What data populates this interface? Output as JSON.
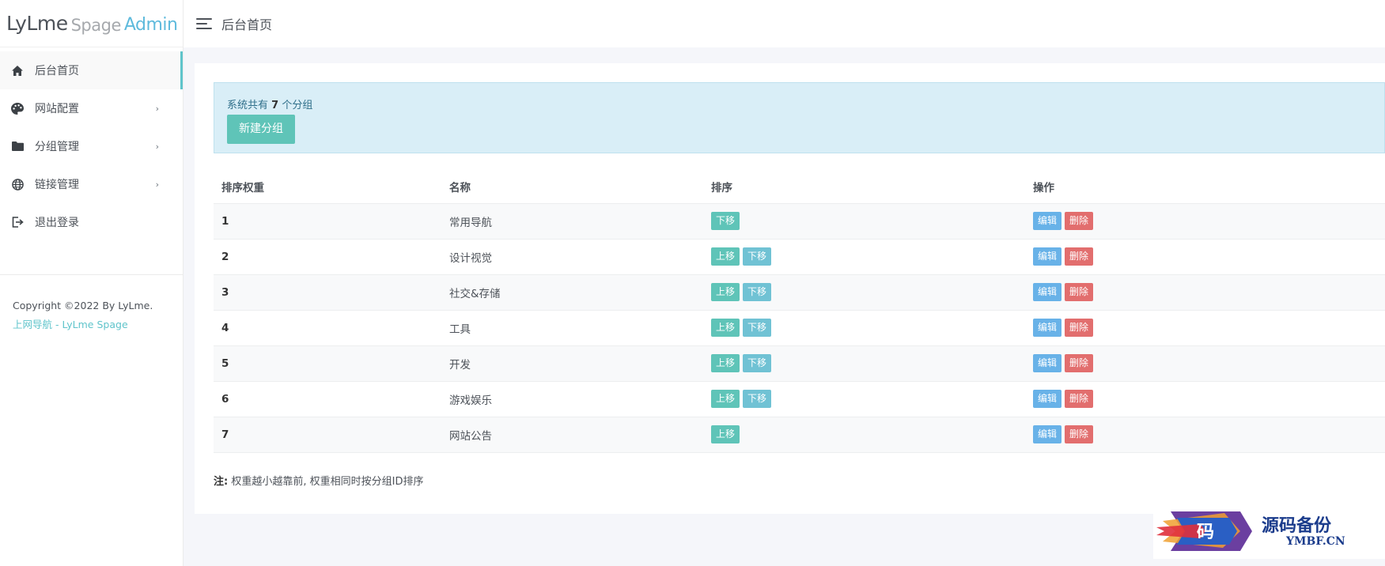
{
  "brand": {
    "part1": "LyLme",
    "part2": "Spage",
    "part3": "Admin"
  },
  "header": {
    "title": "后台首页"
  },
  "sidebar": {
    "items": [
      {
        "label": "后台首页",
        "icon": "home-icon",
        "active": true
      },
      {
        "label": "网站配置",
        "icon": "palette-icon",
        "has_submenu": true
      },
      {
        "label": "分组管理",
        "icon": "folder-icon",
        "has_submenu": true
      },
      {
        "label": "链接管理",
        "icon": "globe-icon",
        "has_submenu": true
      },
      {
        "label": "退出登录",
        "icon": "logout-icon"
      }
    ],
    "copyright": "Copyright ©2022 By LyLme.",
    "link": "上网导航 - LyLme Spage"
  },
  "alert": {
    "prefix": "系统共有",
    "count": "7",
    "suffix": "个分组",
    "new_button": "新建分组"
  },
  "table": {
    "headers": [
      "排序权重",
      "名称",
      "排序",
      "操作"
    ],
    "rows": [
      {
        "weight": "1",
        "name": "常用导航",
        "up": false,
        "down": true
      },
      {
        "weight": "2",
        "name": "设计视觉",
        "up": true,
        "down": true
      },
      {
        "weight": "3",
        "name": "社交&存储",
        "up": true,
        "down": true
      },
      {
        "weight": "4",
        "name": "工具",
        "up": true,
        "down": true
      },
      {
        "weight": "5",
        "name": "开发",
        "up": true,
        "down": true
      },
      {
        "weight": "6",
        "name": "游戏娱乐",
        "up": true,
        "down": true
      },
      {
        "weight": "7",
        "name": "网站公告",
        "up": true,
        "down": false
      }
    ],
    "labels": {
      "up": "上移",
      "down": "下移",
      "edit": "编辑",
      "delete": "删除"
    }
  },
  "note": {
    "label": "注:",
    "text": "权重越小越靠前, 权重相同时按分组ID排序"
  },
  "watermark": {
    "cn": "源码备份",
    "en": "YMBF.CN",
    "char": "码"
  },
  "colors": {
    "accent": "#5fc4b8",
    "edit": "#68b2e8",
    "delete": "#e26e6e",
    "info_bg": "#d9eef7"
  }
}
